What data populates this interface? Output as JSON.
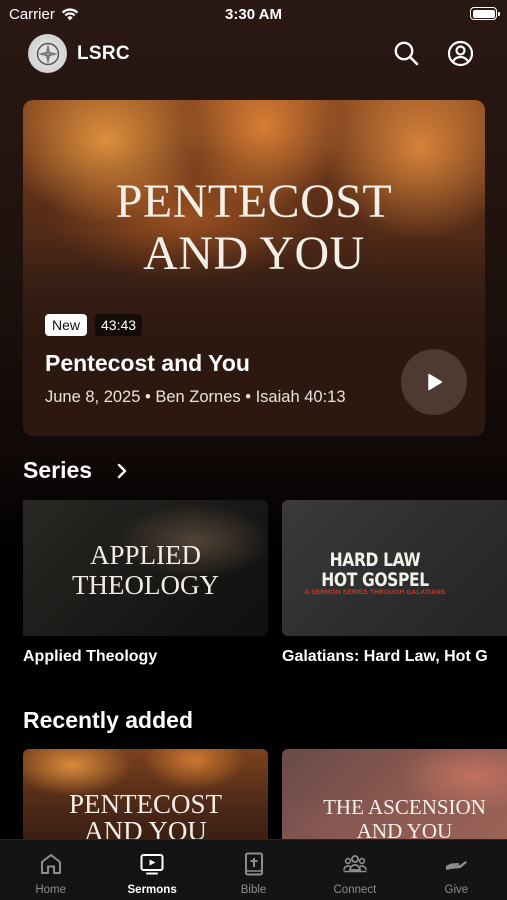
{
  "status_bar": {
    "carrier": "Carrier",
    "time": "3:30 AM",
    "battery_level": 1.0
  },
  "header": {
    "app_name": "LSRC",
    "icons": [
      "logo-icon",
      "search-icon",
      "account-icon"
    ]
  },
  "hero": {
    "artwork_title_line1": "PENTECOST",
    "artwork_title_line2": "AND YOU",
    "badge_new": "New",
    "duration": "43:43",
    "title": "Pentecost and You",
    "meta": "June 8, 2025 • Ben Zornes • Isaiah 40:13",
    "play_icon": "play-icon"
  },
  "series": {
    "section_title": "Series",
    "items": [
      {
        "artwork_line1": "APPLIED",
        "artwork_line2": "THEOLOGY",
        "caption": "Applied Theology"
      },
      {
        "artwork_line1": "HARD LAW",
        "artwork_line2": "HOT GOSPEL",
        "artwork_subtitle": "A SERMON SERIES THROUGH GALATIANS",
        "caption": "Galatians: Hard Law, Hot G"
      }
    ]
  },
  "recently_added": {
    "section_title": "Recently added",
    "items": [
      {
        "artwork_line1": "PENTECOST",
        "artwork_line2": "AND YOU"
      },
      {
        "artwork_line1": "THE ASCENSION",
        "artwork_line2": "AND YOU"
      }
    ]
  },
  "tab_bar": {
    "tabs": [
      {
        "label": "Home",
        "icon": "home-icon",
        "active": false
      },
      {
        "label": "Sermons",
        "icon": "tv-icon",
        "active": true
      },
      {
        "label": "Bible",
        "icon": "bible-icon",
        "active": false
      },
      {
        "label": "Connect",
        "icon": "people-icon",
        "active": false
      },
      {
        "label": "Give",
        "icon": "give-icon",
        "active": false
      }
    ]
  },
  "colors": {
    "background_top": "#2a1813",
    "background_bottom": "#000000",
    "tab_active": "#ffffff",
    "tab_inactive": "#8e8e8e",
    "galatians_accent": "#d23a2a"
  }
}
